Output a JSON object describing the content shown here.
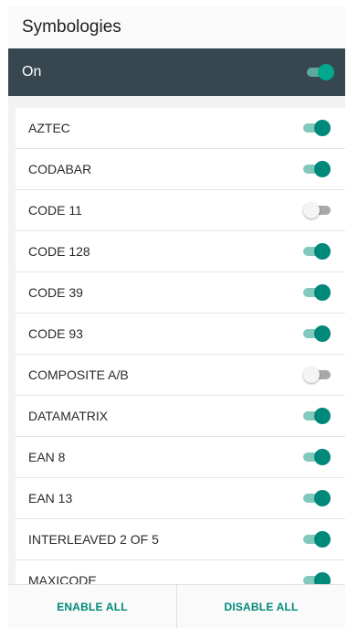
{
  "header": {
    "title": "Symbologies"
  },
  "master": {
    "label": "On",
    "enabled": true
  },
  "symbologies": [
    {
      "label": "AZTEC",
      "enabled": true
    },
    {
      "label": "CODABAR",
      "enabled": true
    },
    {
      "label": "CODE 11",
      "enabled": false
    },
    {
      "label": "CODE 128",
      "enabled": true
    },
    {
      "label": "CODE 39",
      "enabled": true
    },
    {
      "label": "CODE 93",
      "enabled": true
    },
    {
      "label": "COMPOSITE A/B",
      "enabled": false
    },
    {
      "label": "DATAMATRIX",
      "enabled": true
    },
    {
      "label": "EAN 8",
      "enabled": true
    },
    {
      "label": "EAN 13",
      "enabled": true
    },
    {
      "label": "INTERLEAVED 2 OF 5",
      "enabled": true
    },
    {
      "label": "MAXICODE",
      "enabled": true
    }
  ],
  "footer": {
    "enable_all_label": "ENABLE ALL",
    "disable_all_label": "DISABLE ALL"
  },
  "colors": {
    "accent": "#00897b",
    "master_bar": "#37474f"
  }
}
